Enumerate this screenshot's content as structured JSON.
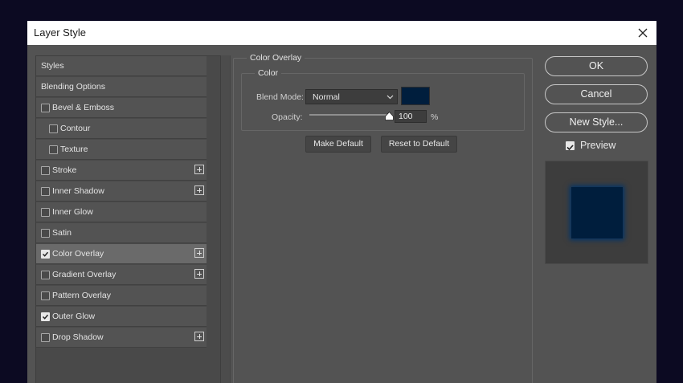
{
  "window": {
    "title": "Layer Style"
  },
  "styles_list": {
    "items": [
      {
        "label": "Styles",
        "checkbox": false,
        "indent": false,
        "plus": false,
        "selected": false
      },
      {
        "label": "Blending Options",
        "checkbox": false,
        "indent": false,
        "plus": false,
        "selected": false
      },
      {
        "label": "Bevel & Emboss",
        "checkbox": true,
        "checked": false,
        "indent": false,
        "plus": false,
        "selected": false
      },
      {
        "label": "Contour",
        "checkbox": true,
        "checked": false,
        "indent": true,
        "plus": false,
        "selected": false
      },
      {
        "label": "Texture",
        "checkbox": true,
        "checked": false,
        "indent": true,
        "plus": false,
        "selected": false
      },
      {
        "label": "Stroke",
        "checkbox": true,
        "checked": false,
        "indent": false,
        "plus": true,
        "selected": false
      },
      {
        "label": "Inner Shadow",
        "checkbox": true,
        "checked": false,
        "indent": false,
        "plus": true,
        "selected": false
      },
      {
        "label": "Inner Glow",
        "checkbox": true,
        "checked": false,
        "indent": false,
        "plus": false,
        "selected": false
      },
      {
        "label": "Satin",
        "checkbox": true,
        "checked": false,
        "indent": false,
        "plus": false,
        "selected": false
      },
      {
        "label": "Color Overlay",
        "checkbox": true,
        "checked": true,
        "indent": false,
        "plus": true,
        "selected": true
      },
      {
        "label": "Gradient Overlay",
        "checkbox": true,
        "checked": false,
        "indent": false,
        "plus": true,
        "selected": false
      },
      {
        "label": "Pattern Overlay",
        "checkbox": true,
        "checked": false,
        "indent": false,
        "plus": false,
        "selected": false
      },
      {
        "label": "Outer Glow",
        "checkbox": true,
        "checked": true,
        "indent": false,
        "plus": false,
        "selected": false
      },
      {
        "label": "Drop Shadow",
        "checkbox": true,
        "checked": false,
        "indent": false,
        "plus": true,
        "selected": false
      }
    ]
  },
  "color_overlay": {
    "section_title": "Color Overlay",
    "group_title": "Color",
    "blend_mode_label": "Blend Mode:",
    "blend_mode_value": "Normal",
    "overlay_color": "#001e3d",
    "opacity_label": "Opacity:",
    "opacity_value": "100",
    "opacity_unit": "%",
    "opacity_fraction": 1.0,
    "make_default_label": "Make Default",
    "reset_default_label": "Reset to Default"
  },
  "actions": {
    "ok_label": "OK",
    "cancel_label": "Cancel",
    "new_style_label": "New Style...",
    "preview_label": "Preview",
    "preview_checked": true
  }
}
